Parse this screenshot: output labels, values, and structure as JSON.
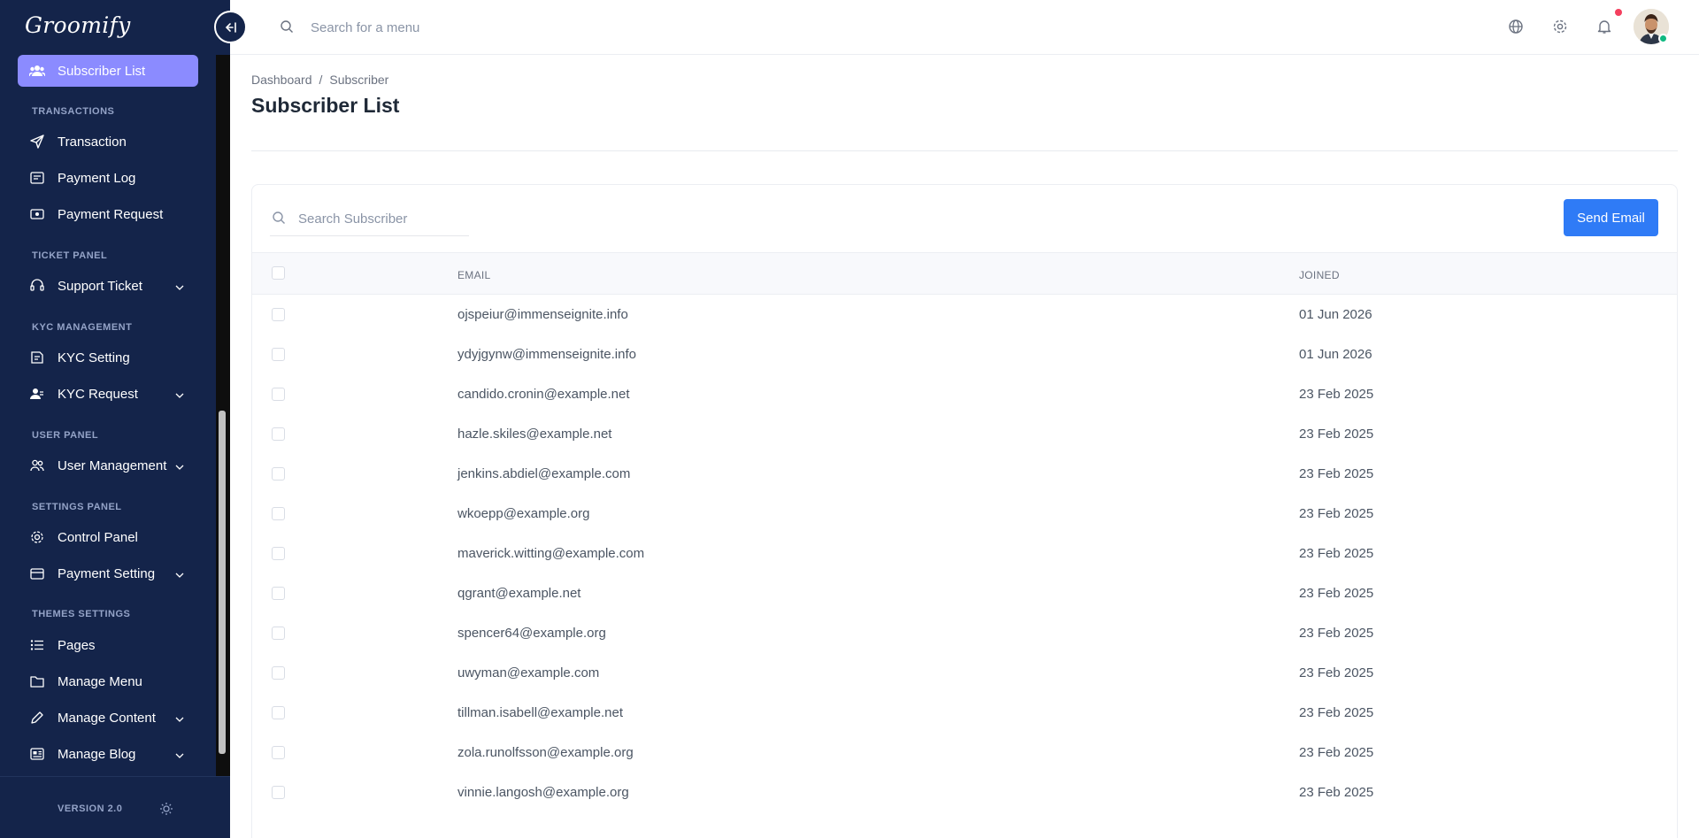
{
  "brand": {
    "name": "Groomify"
  },
  "sidebar": {
    "active_item": "Subscriber List",
    "sections": {
      "transactions": "TRANSACTIONS",
      "ticket_panel": "TICKET PANEL",
      "kyc_management": "KYC MANAGEMENT",
      "user_panel": "USER PANEL",
      "settings_panel": "SETTINGS PANEL",
      "themes_settings": "THEMES SETTINGS"
    },
    "items": {
      "transaction": "Transaction",
      "payment_log": "Payment Log",
      "payment_request": "Payment Request",
      "support_ticket": "Support Ticket",
      "kyc_setting": "KYC Setting",
      "kyc_request": "KYC Request",
      "user_management": "User Management",
      "control_panel": "Control Panel",
      "payment_setting": "Payment Setting",
      "pages": "Pages",
      "manage_menu": "Manage Menu",
      "manage_content": "Manage Content",
      "manage_blog": "Manage Blog"
    },
    "version": "VERSION 2.0"
  },
  "topbar": {
    "search_placeholder": "Search for a menu"
  },
  "page": {
    "breadcrumb": {
      "home": "Dashboard",
      "separator": "/",
      "current": "Subscriber"
    },
    "title": "Subscriber List"
  },
  "card": {
    "search_placeholder": "Search Subscriber",
    "send_button": "Send Email",
    "columns": {
      "email": "EMAIL",
      "joined": "JOINED"
    },
    "rows": [
      {
        "email": "ojspeiur@immenseignite.info",
        "joined": "01 Jun 2026"
      },
      {
        "email": "ydyjgynw@immenseignite.info",
        "joined": "01 Jun 2026"
      },
      {
        "email": "candido.cronin@example.net",
        "joined": "23 Feb 2025"
      },
      {
        "email": "hazle.skiles@example.net",
        "joined": "23 Feb 2025"
      },
      {
        "email": "jenkins.abdiel@example.com",
        "joined": "23 Feb 2025"
      },
      {
        "email": "wkoepp@example.org",
        "joined": "23 Feb 2025"
      },
      {
        "email": "maverick.witting@example.com",
        "joined": "23 Feb 2025"
      },
      {
        "email": "qgrant@example.net",
        "joined": "23 Feb 2025"
      },
      {
        "email": "spencer64@example.org",
        "joined": "23 Feb 2025"
      },
      {
        "email": "uwyman@example.com",
        "joined": "23 Feb 2025"
      },
      {
        "email": "tillman.isabell@example.net",
        "joined": "23 Feb 2025"
      },
      {
        "email": "zola.runolfsson@example.org",
        "joined": "23 Feb 2025"
      },
      {
        "email": "vinnie.langosh@example.org",
        "joined": "23 Feb 2025"
      }
    ]
  },
  "colors": {
    "sidebar_bg": "#14244a",
    "active_item": "#8b8bff",
    "primary_button": "#2f7bf6",
    "notification": "#f43f5e",
    "online": "#10b981"
  }
}
